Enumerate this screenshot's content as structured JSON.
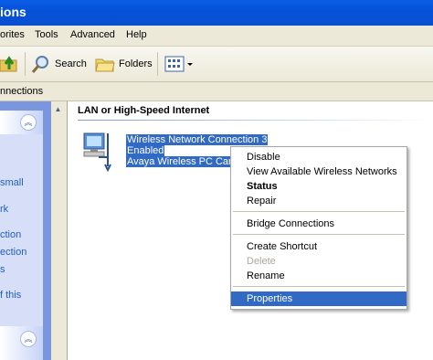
{
  "window": {
    "title_fragment": "ions"
  },
  "menubar": {
    "items": [
      "orites",
      "Tools",
      "Advanced",
      "Help"
    ]
  },
  "toolbar": {
    "search_label": "Search",
    "folders_label": "Folders"
  },
  "address": {
    "text": "nnections"
  },
  "left_pane": {
    "links": [
      "small",
      "rk",
      "ction",
      "ection",
      "s",
      "f this"
    ]
  },
  "main": {
    "group_header": "LAN or High-Speed Internet",
    "connection": {
      "name": "Wireless Network Connection 3",
      "status": "Enabled",
      "device": "Avaya Wireless PC Card"
    }
  },
  "context_menu": {
    "items": [
      "Disable",
      "View Available Wireless Networks",
      "Status",
      "Repair",
      "Bridge Connections",
      "Create Shortcut",
      "Delete",
      "Rename",
      "Properties"
    ]
  }
}
